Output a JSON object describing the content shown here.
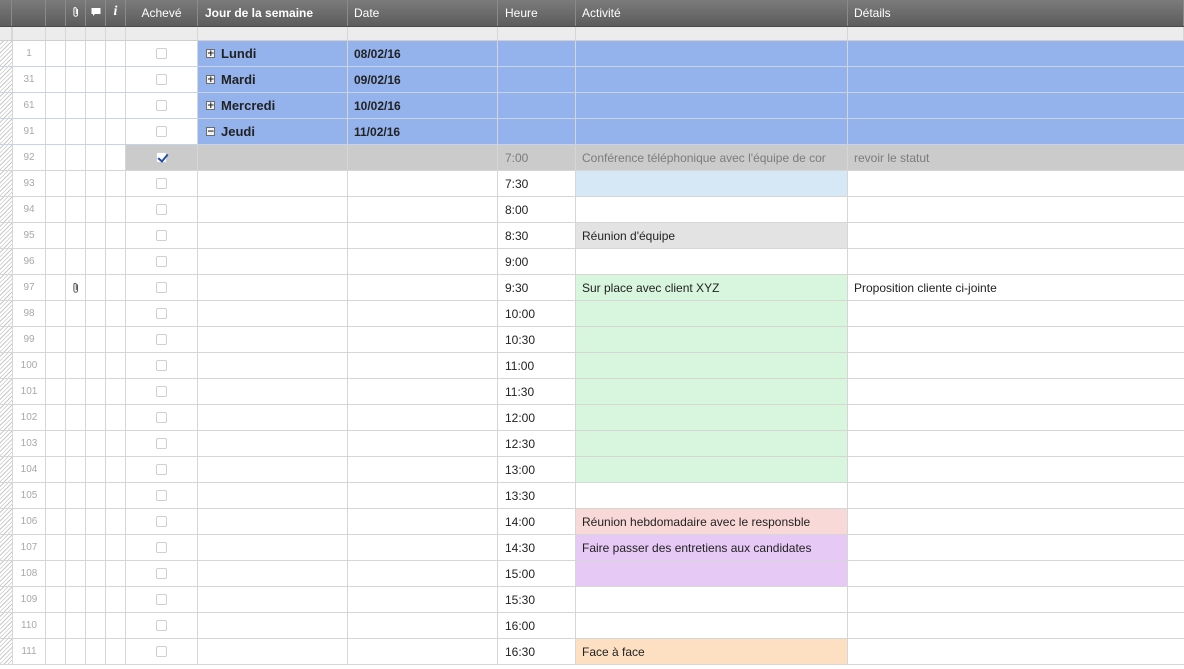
{
  "columns": {
    "done": "Achevé",
    "day": "Jour de la semaine",
    "date": "Date",
    "hour": "Heure",
    "activity": "Activité",
    "details": "Détails",
    "info_icon": "i"
  },
  "parents": [
    {
      "num": "1",
      "toggle": "+",
      "day": "Lundi",
      "date": "08/02/16"
    },
    {
      "num": "31",
      "toggle": "+",
      "day": "Mardi",
      "date": "09/02/16"
    },
    {
      "num": "61",
      "toggle": "+",
      "day": "Mercredi",
      "date": "10/02/16"
    },
    {
      "num": "91",
      "toggle": "−",
      "day": "Jeudi",
      "date": "11/02/16"
    }
  ],
  "rows": [
    {
      "num": "92",
      "done": true,
      "hour": "7:00",
      "activity": "Conférence téléphonique avec l'équipe de cor",
      "details": "revoir le statut",
      "color": "#cbcbcb",
      "attach": false
    },
    {
      "num": "93",
      "done": false,
      "hour": "7:30",
      "activity": "",
      "details": "",
      "color": "#d6e7f6",
      "attach": false
    },
    {
      "num": "94",
      "done": false,
      "hour": "8:00",
      "activity": "",
      "details": "",
      "color": "",
      "attach": false
    },
    {
      "num": "95",
      "done": false,
      "hour": "8:30",
      "activity": "Réunion d'équipe",
      "details": "",
      "color": "#e3e3e3",
      "attach": false
    },
    {
      "num": "96",
      "done": false,
      "hour": "9:00",
      "activity": "",
      "details": "",
      "color": "",
      "attach": false
    },
    {
      "num": "97",
      "done": false,
      "hour": "9:30",
      "activity": "Sur place avec client XYZ",
      "details": "Proposition cliente ci-jointe",
      "color": "#d8f5dd",
      "attach": true
    },
    {
      "num": "98",
      "done": false,
      "hour": "10:00",
      "activity": "",
      "details": "",
      "color": "#d8f5dd",
      "attach": false
    },
    {
      "num": "99",
      "done": false,
      "hour": "10:30",
      "activity": "",
      "details": "",
      "color": "#d8f5dd",
      "attach": false
    },
    {
      "num": "100",
      "done": false,
      "hour": "11:00",
      "activity": "",
      "details": "",
      "color": "#d8f5dd",
      "attach": false
    },
    {
      "num": "101",
      "done": false,
      "hour": "11:30",
      "activity": "",
      "details": "",
      "color": "#d8f5dd",
      "attach": false
    },
    {
      "num": "102",
      "done": false,
      "hour": "12:00",
      "activity": "",
      "details": "",
      "color": "#d8f5dd",
      "attach": false
    },
    {
      "num": "103",
      "done": false,
      "hour": "12:30",
      "activity": "",
      "details": "",
      "color": "#d8f5dd",
      "attach": false
    },
    {
      "num": "104",
      "done": false,
      "hour": "13:00",
      "activity": "",
      "details": "",
      "color": "#d8f5dd",
      "attach": false
    },
    {
      "num": "105",
      "done": false,
      "hour": "13:30",
      "activity": "",
      "details": "",
      "color": "",
      "attach": false
    },
    {
      "num": "106",
      "done": false,
      "hour": "14:00",
      "activity": "Réunion hebdomadaire avec le responsble",
      "details": "",
      "color": "#f9d9d7",
      "attach": false
    },
    {
      "num": "107",
      "done": false,
      "hour": "14:30",
      "activity": "Faire passer des entretiens aux candidates",
      "details": "",
      "color": "#e6c9f5",
      "attach": false
    },
    {
      "num": "108",
      "done": false,
      "hour": "15:00",
      "activity": "",
      "details": "",
      "color": "#e6c9f5",
      "attach": false
    },
    {
      "num": "109",
      "done": false,
      "hour": "15:30",
      "activity": "",
      "details": "",
      "color": "",
      "attach": false
    },
    {
      "num": "110",
      "done": false,
      "hour": "16:00",
      "activity": "",
      "details": "",
      "color": "",
      "attach": false
    },
    {
      "num": "111",
      "done": false,
      "hour": "16:30",
      "activity": "Face à face",
      "details": "",
      "color": "#fde0c2",
      "attach": false
    }
  ],
  "colors": {
    "parent_row": "#94b3ec",
    "header_bg": "#6b6b6b",
    "checked_row": "#cbcbcb"
  }
}
